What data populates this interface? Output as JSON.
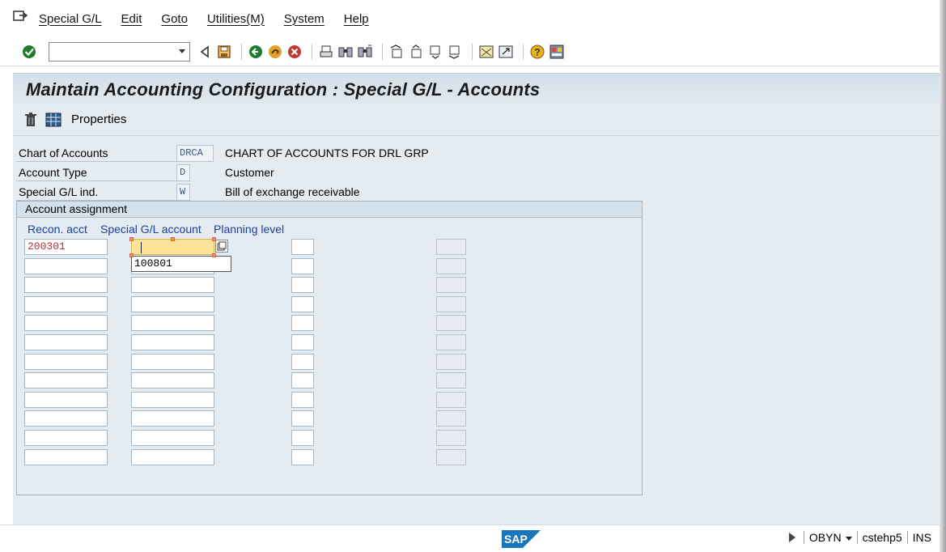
{
  "menubar": {
    "items": [
      {
        "label": "Special G/L"
      },
      {
        "label": "Edit"
      },
      {
        "label": "Goto"
      },
      {
        "label": "Utilities(M)"
      },
      {
        "label": "System"
      },
      {
        "label": "Help"
      }
    ]
  },
  "toolbar": {
    "command_value": ""
  },
  "title": "Maintain Accounting Configuration : Special G/L - Accounts",
  "app_toolbar": {
    "properties_label": "Properties"
  },
  "fields": {
    "chart_of_accounts": {
      "label": "Chart of Accounts",
      "value": "DRCA",
      "desc": "CHART OF ACCOUNTS FOR DRL GRP"
    },
    "account_type": {
      "label": "Account Type",
      "value": "D",
      "desc": "Customer"
    },
    "special_gl_ind": {
      "label": "Special G/L ind.",
      "value": "W",
      "desc": "Bill of exchange receivable"
    }
  },
  "assignment": {
    "title": "Account assignment",
    "headers": {
      "recon": "Recon. acct",
      "special": "Special G/L account",
      "planning": "Planning level"
    },
    "first_row": {
      "recon": "200301",
      "special": ""
    },
    "dropdown_value": "100801"
  },
  "status": {
    "transaction": "OBYN",
    "server": "cstehp5",
    "mode": "INS"
  },
  "colors": {
    "title_bg": "#d4e0ea",
    "content_bg": "#e4ebf1",
    "header_blue": "#1d3f9e",
    "value_red": "#b8302a",
    "focus_yellow": "#fbe49a"
  }
}
